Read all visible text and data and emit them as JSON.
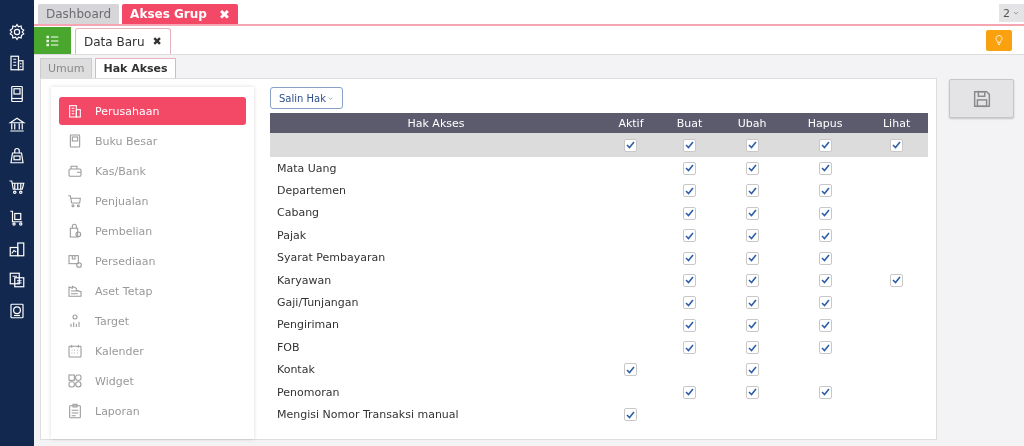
{
  "top_tabs": [
    {
      "label": "Dashboard",
      "selected": false
    },
    {
      "label": "Akses Grup",
      "selected": true,
      "close": "✖"
    }
  ],
  "window_counter": "2",
  "sub_tabs": [
    {
      "label": "Data Baru",
      "selected": true,
      "close": "✖"
    }
  ],
  "form_tabs": [
    {
      "label": "Umum",
      "selected": false
    },
    {
      "label": "Hak Akses",
      "selected": true
    }
  ],
  "modules": [
    {
      "label": "Perusahaan",
      "selected": true
    },
    {
      "label": "Buku Besar",
      "selected": false
    },
    {
      "label": "Kas/Bank",
      "selected": false
    },
    {
      "label": "Penjualan",
      "selected": false
    },
    {
      "label": "Pembelian",
      "selected": false
    },
    {
      "label": "Persediaan",
      "selected": false
    },
    {
      "label": "Aset Tetap",
      "selected": false
    },
    {
      "label": "Target",
      "selected": false
    },
    {
      "label": "Kalender",
      "selected": false
    },
    {
      "label": "Widget",
      "selected": false
    },
    {
      "label": "Laporan",
      "selected": false
    }
  ],
  "copy_button": "Salin Hak",
  "table": {
    "columns": [
      "Hak Akses",
      "Aktif",
      "Buat",
      "Ubah",
      "Hapus",
      "Lihat"
    ],
    "select_all": {
      "aktif": true,
      "buat": true,
      "ubah": true,
      "hapus": true,
      "lihat": true
    },
    "rows": [
      {
        "label": "Mata Uang",
        "checks": {
          "buat": true,
          "ubah": true,
          "hapus": true
        }
      },
      {
        "label": "Departemen",
        "checks": {
          "buat": true,
          "ubah": true,
          "hapus": true
        }
      },
      {
        "label": "Cabang",
        "checks": {
          "buat": true,
          "ubah": true,
          "hapus": true
        }
      },
      {
        "label": "Pajak",
        "checks": {
          "buat": true,
          "ubah": true,
          "hapus": true
        }
      },
      {
        "label": "Syarat Pembayaran",
        "checks": {
          "buat": true,
          "ubah": true,
          "hapus": true
        }
      },
      {
        "label": "Karyawan",
        "checks": {
          "buat": true,
          "ubah": true,
          "hapus": true,
          "lihat": true
        }
      },
      {
        "label": "Gaji/Tunjangan",
        "checks": {
          "buat": true,
          "ubah": true,
          "hapus": true
        }
      },
      {
        "label": "Pengiriman",
        "checks": {
          "buat": true,
          "ubah": true,
          "hapus": true
        }
      },
      {
        "label": "FOB",
        "checks": {
          "buat": true,
          "ubah": true,
          "hapus": true
        }
      },
      {
        "label": "Kontak",
        "checks": {
          "aktif": true,
          "ubah": true
        }
      },
      {
        "label": "Penomoran",
        "checks": {
          "buat": true,
          "ubah": true,
          "hapus": true
        }
      },
      {
        "label": "Mengisi Nomor Transaksi manual",
        "checks": {
          "aktif": true
        }
      }
    ]
  }
}
